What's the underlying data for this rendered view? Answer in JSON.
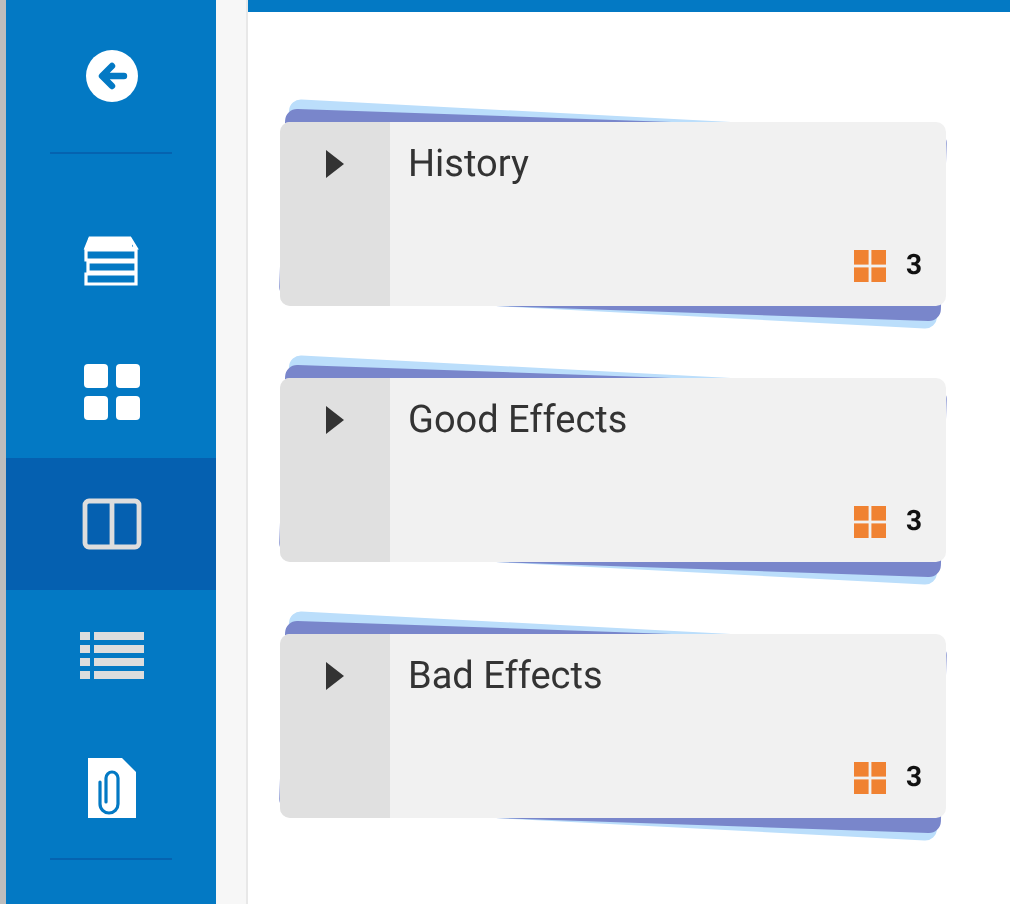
{
  "sidebar": {
    "back": {
      "kind": "back"
    },
    "items": [
      {
        "kind": "books",
        "selected": false
      },
      {
        "kind": "grid",
        "selected": false
      },
      {
        "kind": "columns",
        "selected": true
      },
      {
        "kind": "list",
        "selected": false
      },
      {
        "kind": "attachment",
        "selected": false
      }
    ]
  },
  "cards": [
    {
      "title": "History",
      "count": "3",
      "expanded": false
    },
    {
      "title": "Good Effects",
      "count": "3",
      "expanded": false
    },
    {
      "title": "Bad Effects",
      "count": "3",
      "expanded": false
    }
  ]
}
